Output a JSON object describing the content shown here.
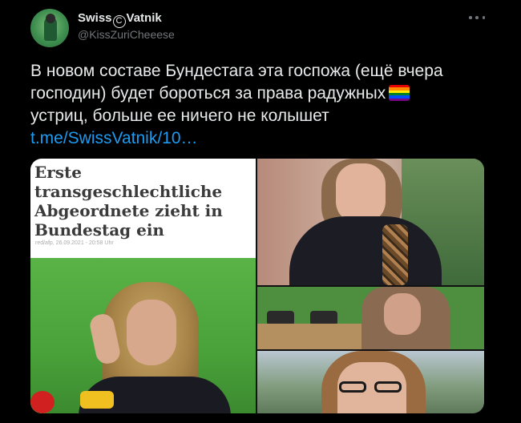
{
  "author": {
    "display_name_part1": "Swiss",
    "display_name_symbol": "C",
    "display_name_part2": "Vatnik",
    "handle": "@KissZuriCheeese"
  },
  "tweet": {
    "line1": "В новом составе Бундестага эта госпожа (ещё вчера",
    "line2": "господин) будет бороться за права радужных",
    "line3": "устриц, больше ее ничего не колышет",
    "link": "t.me/SwissVatnik/10…"
  },
  "rainbow_colors": [
    "#e40303",
    "#ff8c00",
    "#ffed00",
    "#008026",
    "#004dff",
    "#750787"
  ],
  "media": {
    "headline_lines": [
      "Erste",
      "transgeschlechtliche",
      "Abgeordnete zieht in",
      "Bundestag ein"
    ],
    "meta": "red/afp, 26.09.2021 - 20:58 Uhr"
  }
}
